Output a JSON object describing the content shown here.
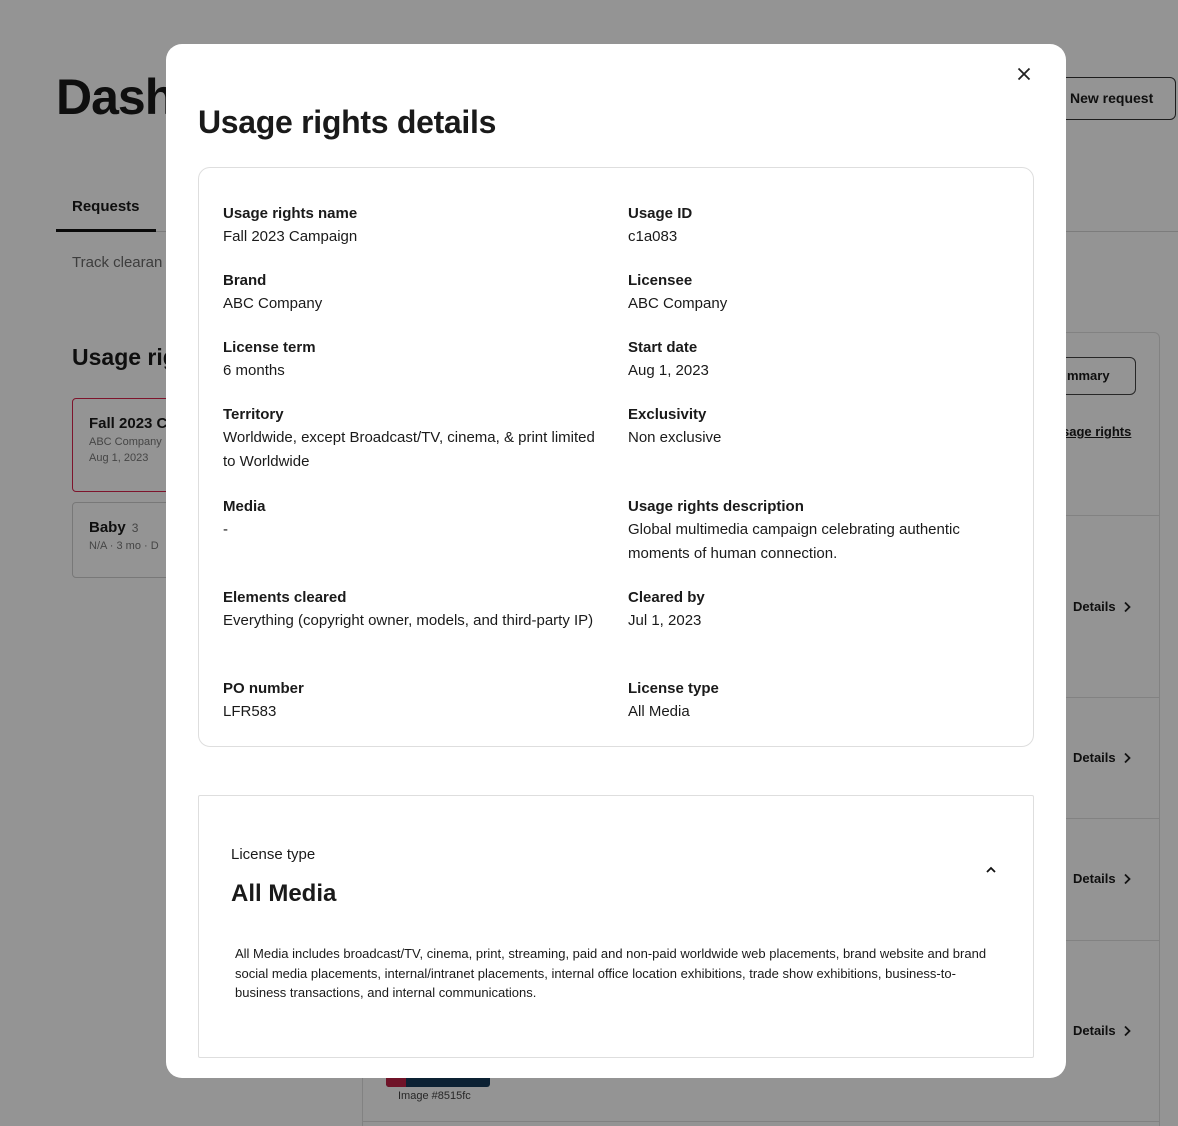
{
  "background": {
    "page_title": "Dashb",
    "new_request_label": "New request",
    "tab_requests": "Requests",
    "track_text": "Track clearan",
    "usage_heading": "Usage rig",
    "cards": [
      {
        "title": "Fall 2023 C",
        "count": "",
        "line1": "ABC Company",
        "line2": "Aug 1, 2023"
      },
      {
        "title": "Baby",
        "count": "3",
        "line1": "N/A · 3 mo · D",
        "line2": ""
      }
    ],
    "summary_label": "ummary",
    "usage_rights_link": "sage rights",
    "details_label": "Details",
    "image_label": "Image #8515fc"
  },
  "modal": {
    "title": "Usage rights details",
    "close_icon": "close-icon",
    "fields": [
      {
        "label": "Usage rights name",
        "value": "Fall 2023 Campaign"
      },
      {
        "label": "Usage ID",
        "value": "c1a083"
      },
      {
        "label": "Brand",
        "value": "ABC Company"
      },
      {
        "label": "Licensee",
        "value": "ABC Company"
      },
      {
        "label": "License term",
        "value": "6 months"
      },
      {
        "label": "Start date",
        "value": "Aug 1, 2023"
      },
      {
        "label": "Territory",
        "value": "Worldwide, except Broadcast/TV, cinema, & print limited to Worldwide"
      },
      {
        "label": "Exclusivity",
        "value": "Non exclusive"
      },
      {
        "label": "Media",
        "value": "-"
      },
      {
        "label": "Usage rights description",
        "value": "Global multimedia campaign celebrating authentic moments of human connection."
      },
      {
        "label": "Elements cleared",
        "value": "Everything (copyright owner, models, and third-party IP)"
      },
      {
        "label": "Cleared by",
        "value": "Jul 1, 2023"
      },
      {
        "label": "PO number",
        "value": "LFR583"
      },
      {
        "label": "License type",
        "value": "All Media"
      }
    ],
    "license_section": {
      "label": "License type",
      "value": "All Media",
      "toggle_icon": "chevron-up-icon",
      "description": "All Media includes broadcast/TV, cinema, print, streaming, paid and non-paid worldwide web placements, brand website and brand social media placements, internal/intranet placements, internal office location exhibitions, trade show exhibitions, business-to-business transactions, and internal communications."
    }
  }
}
